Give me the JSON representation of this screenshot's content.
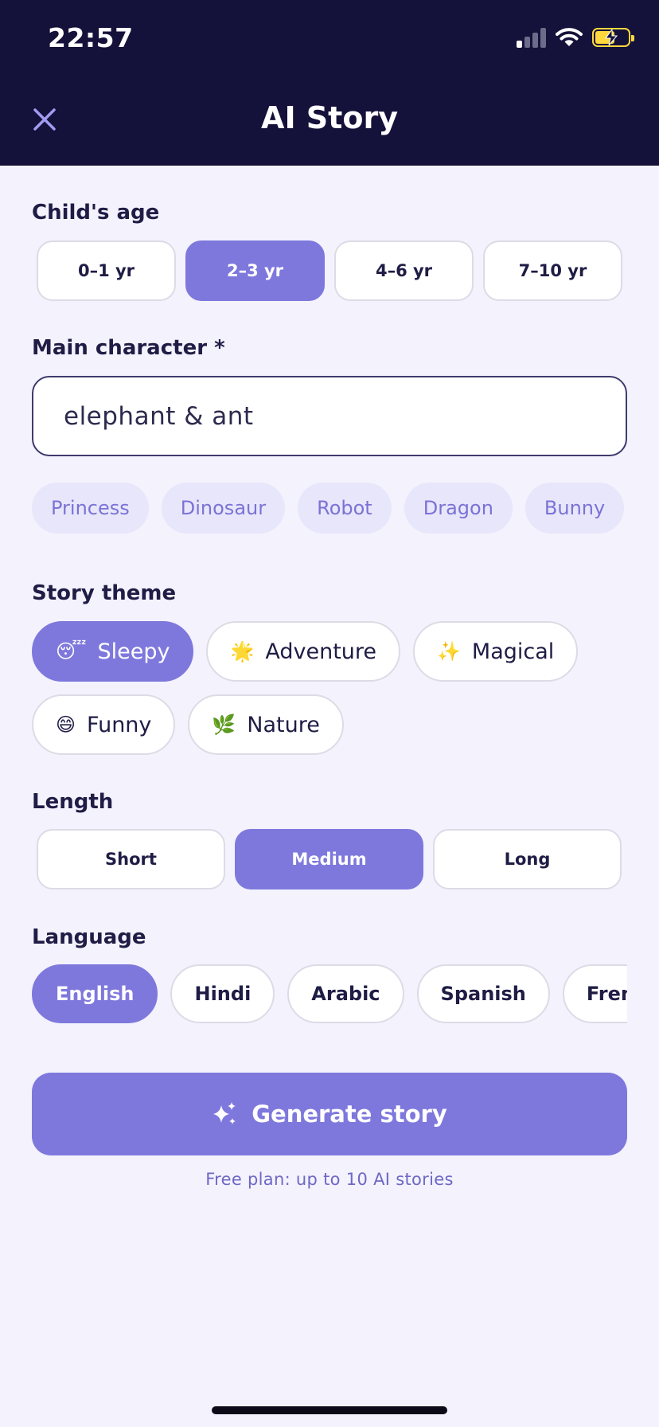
{
  "status_bar": {
    "time": "22:57"
  },
  "header": {
    "title": "AI Story",
    "close_icon": "close-icon"
  },
  "age": {
    "label": "Child's age",
    "options": [
      "0–1 yr",
      "2–3 yr",
      "4–6 yr",
      "7–10 yr"
    ],
    "selected": "2–3 yr"
  },
  "character": {
    "label": "Main character *",
    "value": "elephant & ant",
    "suggestions": [
      "Princess",
      "Dinosaur",
      "Robot",
      "Dragon",
      "Bunny"
    ]
  },
  "theme": {
    "label": "Story theme",
    "options": [
      {
        "emoji": "😴",
        "label": "Sleepy"
      },
      {
        "emoji": "🌟",
        "label": "Adventure"
      },
      {
        "emoji": "✨",
        "label": "Magical"
      },
      {
        "emoji": "😄",
        "label": "Funny"
      },
      {
        "emoji": "🌿",
        "label": "Nature"
      }
    ],
    "selected": "Sleepy"
  },
  "length": {
    "label": "Length",
    "options": [
      "Short",
      "Medium",
      "Long"
    ],
    "selected": "Medium"
  },
  "language": {
    "label": "Language",
    "options": [
      "English",
      "Hindi",
      "Arabic",
      "Spanish",
      "French"
    ],
    "selected": "English"
  },
  "generate": {
    "label": "Generate story",
    "icon": "sparkles-icon"
  },
  "footnote": "Free plan: up to 10 AI stories",
  "colors": {
    "header_bg": "#14113a",
    "accent": "#7e78dd",
    "page_bg": "#f3f2fd",
    "battery": "#ffd83d"
  }
}
